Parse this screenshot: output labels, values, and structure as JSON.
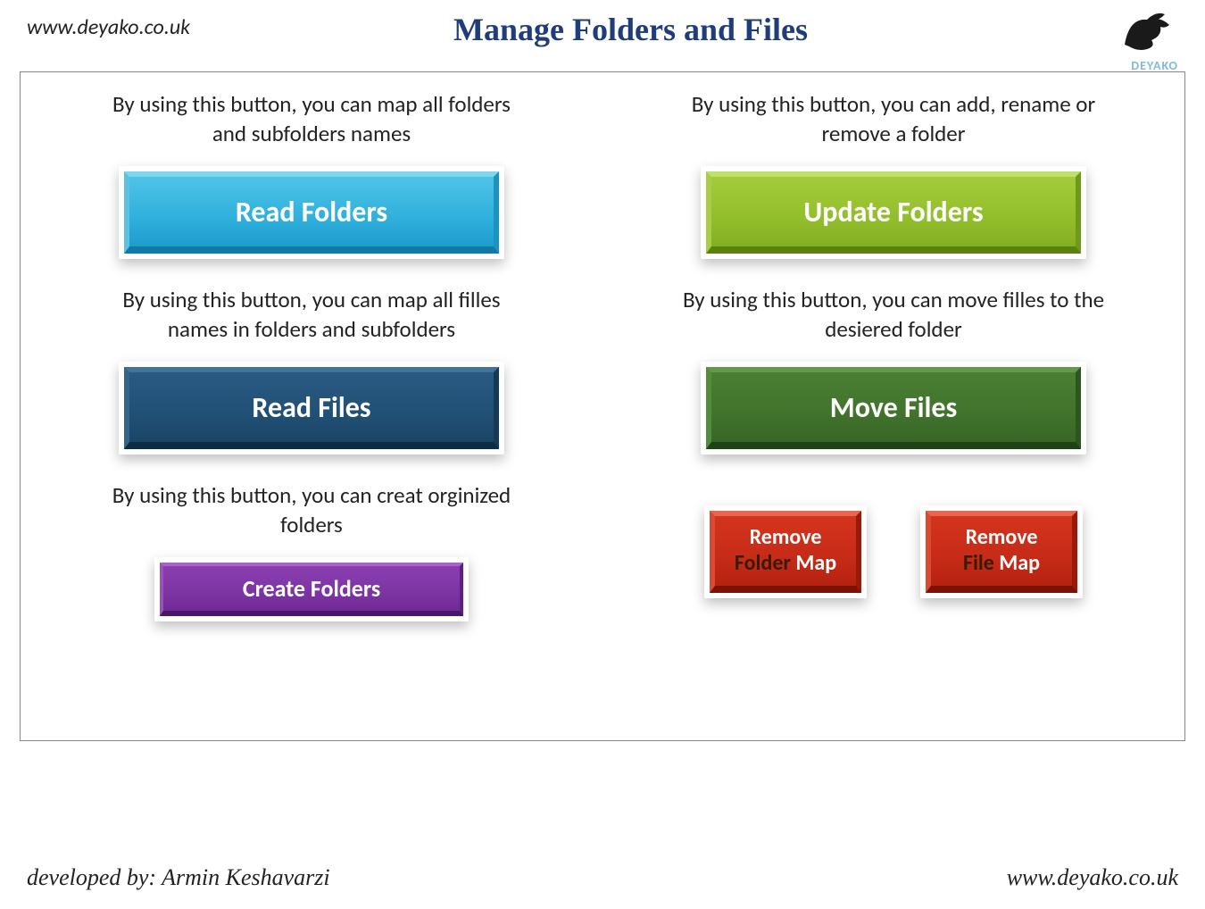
{
  "header": {
    "url": "www.deyako.co.uk",
    "title": "Manage Folders and Files",
    "logo_text": "DEYAKO"
  },
  "sections": {
    "read_folders": {
      "desc": "By using this button, you can map all folders and subfolders names",
      "label": "Read Folders"
    },
    "update_folders": {
      "desc": "By using this button, you can add, rename or remove a folder",
      "label": "Update Folders"
    },
    "read_files": {
      "desc": "By using this button, you can map all filles names in folders and subfolders",
      "label": "Read Files"
    },
    "move_files": {
      "desc": "By using this button, you can move filles to the desiered folder",
      "label": "Move Files"
    },
    "create_folders": {
      "desc": "By using this button, you can creat orginized folders",
      "label": "Create Folders"
    },
    "remove_folder_map": {
      "line1": "Remove",
      "dark": "Folder",
      "line2_rest": " Map"
    },
    "remove_file_map": {
      "line1": "Remove",
      "dark": "File",
      "line2_rest": " Map"
    }
  },
  "footer": {
    "developed_by": "developed by: Armin Keshavarzi",
    "url": "www.deyako.co.uk"
  }
}
